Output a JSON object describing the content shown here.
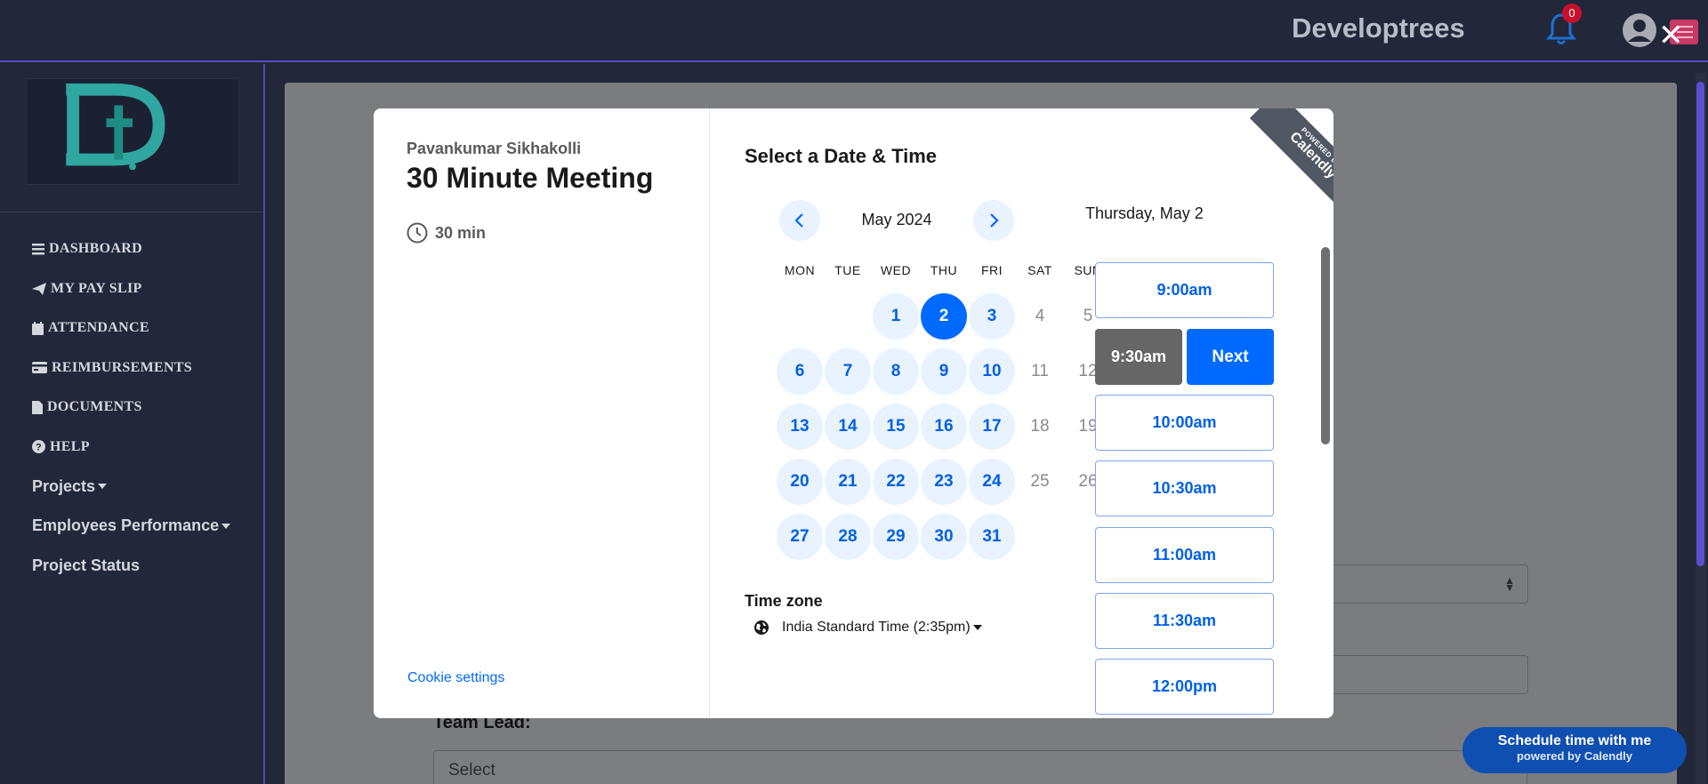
{
  "header": {
    "brand": "Developtrees",
    "notification_count": "0"
  },
  "sidebar": {
    "items": [
      {
        "label": "DASHBOARD",
        "icon": "bars-icon"
      },
      {
        "label": "MY PAY SLIP",
        "icon": "paper-plane-icon"
      },
      {
        "label": "ATTENDANCE",
        "icon": "calendar-icon"
      },
      {
        "label": "REIMBURSEMENTS",
        "icon": "credit-card-icon"
      },
      {
        "label": "DOCUMENTS",
        "icon": "file-icon"
      },
      {
        "label": "HELP",
        "icon": "question-circle-icon"
      },
      {
        "label": "Projects",
        "icon": "caret-down-icon"
      },
      {
        "label": "Employees Performance",
        "icon": "caret-down-icon"
      },
      {
        "label": "Project Status",
        "icon": ""
      }
    ]
  },
  "background_form": {
    "team_lead_label": "Team Lead:",
    "team_lead_value": "Select"
  },
  "modal": {
    "host_name": "Pavankumar Sikhakolli",
    "event_title": "30 Minute Meeting",
    "duration": "30 min",
    "cookie_settings": "Cookie settings",
    "select_title": "Select a Date & Time",
    "month_label": "May 2024",
    "weekdays": [
      "MON",
      "TUE",
      "WED",
      "THU",
      "FRI",
      "SAT",
      "SUN"
    ],
    "weeks": [
      [
        null,
        null,
        {
          "d": "1",
          "s": "avail"
        },
        {
          "d": "2",
          "s": "sel"
        },
        {
          "d": "3",
          "s": "avail"
        },
        {
          "d": "4",
          "s": "off"
        },
        {
          "d": "5",
          "s": "off"
        }
      ],
      [
        {
          "d": "6",
          "s": "avail"
        },
        {
          "d": "7",
          "s": "avail"
        },
        {
          "d": "8",
          "s": "avail"
        },
        {
          "d": "9",
          "s": "avail"
        },
        {
          "d": "10",
          "s": "avail"
        },
        {
          "d": "11",
          "s": "off"
        },
        {
          "d": "12",
          "s": "off"
        }
      ],
      [
        {
          "d": "13",
          "s": "avail"
        },
        {
          "d": "14",
          "s": "avail"
        },
        {
          "d": "15",
          "s": "avail"
        },
        {
          "d": "16",
          "s": "avail"
        },
        {
          "d": "17",
          "s": "avail"
        },
        {
          "d": "18",
          "s": "off"
        },
        {
          "d": "19",
          "s": "off"
        }
      ],
      [
        {
          "d": "20",
          "s": "avail"
        },
        {
          "d": "21",
          "s": "avail"
        },
        {
          "d": "22",
          "s": "avail"
        },
        {
          "d": "23",
          "s": "avail"
        },
        {
          "d": "24",
          "s": "avail"
        },
        {
          "d": "25",
          "s": "off"
        },
        {
          "d": "26",
          "s": "off"
        }
      ],
      [
        {
          "d": "27",
          "s": "avail"
        },
        {
          "d": "28",
          "s": "avail"
        },
        {
          "d": "29",
          "s": "avail"
        },
        {
          "d": "30",
          "s": "avail"
        },
        {
          "d": "31",
          "s": "avail"
        },
        null,
        null
      ]
    ],
    "timezone_label": "Time zone",
    "timezone_value": "India Standard Time (2:35pm)",
    "selected_date": "Thursday, May 2",
    "slots": [
      "9:00am",
      "9:30am",
      "10:00am",
      "10:30am",
      "11:00am",
      "11:30am",
      "12:00pm"
    ],
    "selected_slot": "9:30am",
    "next_label": "Next",
    "ribbon_small": "POWERED BY",
    "ribbon_large": "Calendly"
  },
  "calendly_badge": {
    "line1": "Schedule time with me",
    "line2": "powered by Calendly"
  },
  "colors": {
    "accent": "#0069ff",
    "sidebar_bg": "#222739"
  }
}
